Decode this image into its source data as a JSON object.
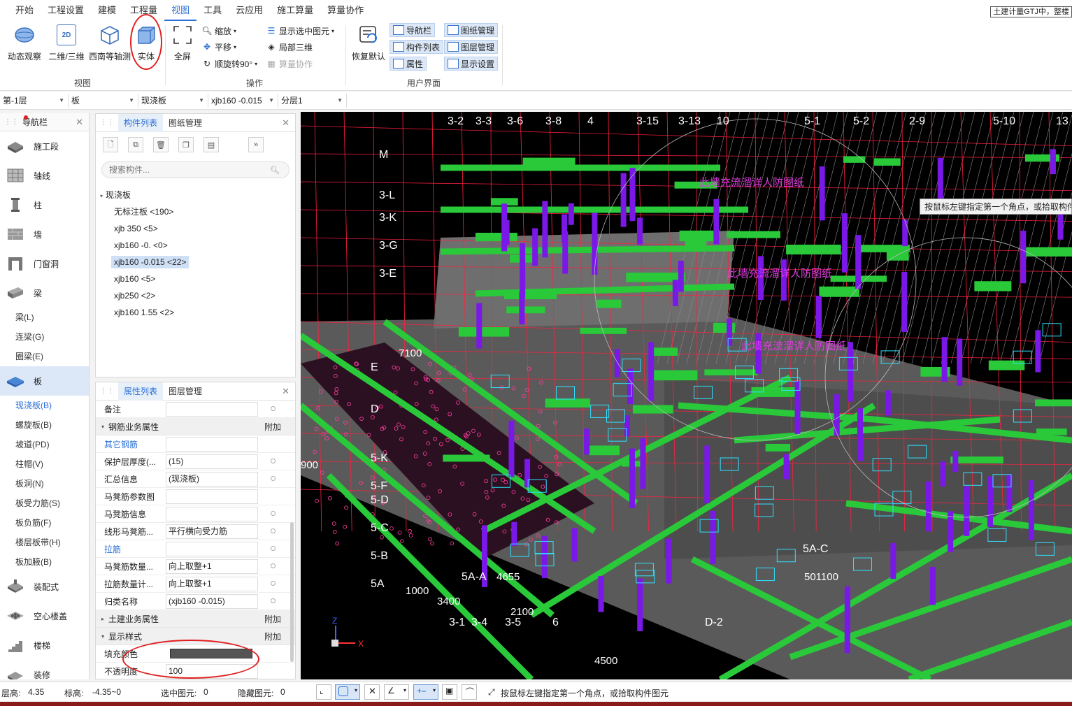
{
  "menubar": {
    "items": [
      "开始",
      "工程设置",
      "建模",
      "工程量",
      "视图",
      "工具",
      "云应用",
      "施工算量",
      "算量协作"
    ],
    "active_index": 4,
    "notice": "土建计量GTJ中，整楼"
  },
  "ribbon": {
    "view_group": {
      "label": "视图",
      "buttons": [
        "动态观察",
        "二维/三维",
        "西南等轴测",
        "实体"
      ]
    },
    "ops_group": {
      "label": "操作",
      "fullscreen": "全屏",
      "zoom": "缩放",
      "pan": "平移",
      "rotate": "顺旋转90°",
      "show_selected": "显示选中图元",
      "local_3d": "局部三维",
      "calc_collab": "算量协作"
    },
    "ui_group": {
      "label": "用户界面",
      "restore": "恢复默认",
      "toggles": [
        "导航栏",
        "构件列表",
        "属性",
        "图纸管理",
        "图层管理",
        "显示设置"
      ]
    },
    "twod_badge": "2D"
  },
  "selectors": {
    "floor": "第-1层",
    "category": "板",
    "type": "现浇板",
    "component": "xjb160 -0.015",
    "layer": "分层1"
  },
  "nav": {
    "title": "导航栏",
    "categories": [
      {
        "label": "施工段"
      },
      {
        "label": "轴线"
      },
      {
        "label": "柱"
      },
      {
        "label": "墙"
      },
      {
        "label": "门窗洞"
      },
      {
        "label": "梁"
      }
    ],
    "beam_subs": [
      "梁(L)",
      "连梁(G)",
      "圈梁(E)"
    ],
    "slab": "板",
    "slab_subs": [
      "现浇板(B)",
      "螺旋板(B)",
      "坡道(PD)",
      "柱帽(V)",
      "板洞(N)",
      "板受力筋(S)",
      "板负筋(F)",
      "楼层板带(H)",
      "板加腋(B)"
    ],
    "more": [
      "装配式",
      "空心楼盖",
      "楼梯",
      "装修"
    ]
  },
  "complist": {
    "tabs": [
      "构件列表",
      "图纸管理"
    ],
    "search_placeholder": "搜索构件...",
    "root": "现浇板",
    "items": [
      "无标注板 <190>",
      "xjb 350 <5>",
      "xjb160 -0. <0>",
      "xjb160 -0.015 <22>",
      "xjb160 <5>",
      "xjb250 <2>",
      "xjb160 1.55 <2>"
    ],
    "selected_index": 3
  },
  "props": {
    "tabs": [
      "属性列表",
      "图层管理"
    ],
    "note_label": "备注",
    "rebar_group": "钢筋业务属性",
    "add": "附加",
    "rows": [
      {
        "name": "其它钢筋",
        "value": "",
        "blue": true
      },
      {
        "name": "保护层厚度(...",
        "value": "(15)",
        "blue": false
      },
      {
        "name": "汇总信息",
        "value": "(现浇板)",
        "blue": false
      },
      {
        "name": "马凳筋参数图",
        "value": "",
        "blue": false
      },
      {
        "name": "马凳筋信息",
        "value": "",
        "blue": false
      },
      {
        "name": "线形马凳筋...",
        "value": "平行横向受力筋",
        "blue": false
      },
      {
        "name": "拉筋",
        "value": "",
        "blue": true
      },
      {
        "name": "马凳筋数量...",
        "value": "向上取整+1",
        "blue": false
      },
      {
        "name": "拉筋数量计...",
        "value": "向上取整+1",
        "blue": false
      },
      {
        "name": "归类名称",
        "value": "(xjb160 -0.015)",
        "blue": false
      }
    ],
    "civil_group": "土建业务属性",
    "display_group": "显示样式",
    "fill_color_label": "填充颜色",
    "opacity_label": "不透明度",
    "opacity_value": "100",
    "fill_color": "#555555"
  },
  "viewport": {
    "tooltip": "按鼠标左键指定第一个角点，或拾取构件",
    "axis_labels": [
      "3-2",
      "3-3",
      "3-6",
      "3-8",
      "4",
      "3-15",
      "3-13",
      "10",
      "5-1",
      "5-2",
      "2-9",
      "5-10",
      "13",
      "M",
      "3-L",
      "3-K",
      "3-G",
      "3-E",
      "E",
      "D",
      "5-K",
      "5-F",
      "5-D",
      "5-C",
      "5-B",
      "5A",
      "5A-A",
      "5A-C",
      "3-1",
      "3-4",
      "3-5",
      "6",
      "D-2"
    ],
    "dims": [
      "501100",
      "4655",
      "3400",
      "4500",
      "900",
      "7100",
      "1000",
      "2100"
    ],
    "magenta_texts": [
      "此墙充流溜详人防图纸",
      "此墙充流溜详人防图纸",
      "此墙充流溜详人防图纸"
    ],
    "colors": {
      "beam": "#29c93a",
      "column": "#7a18e8",
      "slab": "#707070",
      "grid": "#ff2040",
      "text": "#ffffff"
    }
  },
  "status": {
    "floor_h": "层高:",
    "floor_h_val": "4.35",
    "elev": "标高:",
    "elev_val": "-4.35~0",
    "sel": "选中图元:",
    "sel_val": "0",
    "hidden": "隐藏图元:",
    "hidden_val": "0",
    "hint": "按鼠标左键指定第一个角点，或拾取构件图元"
  }
}
